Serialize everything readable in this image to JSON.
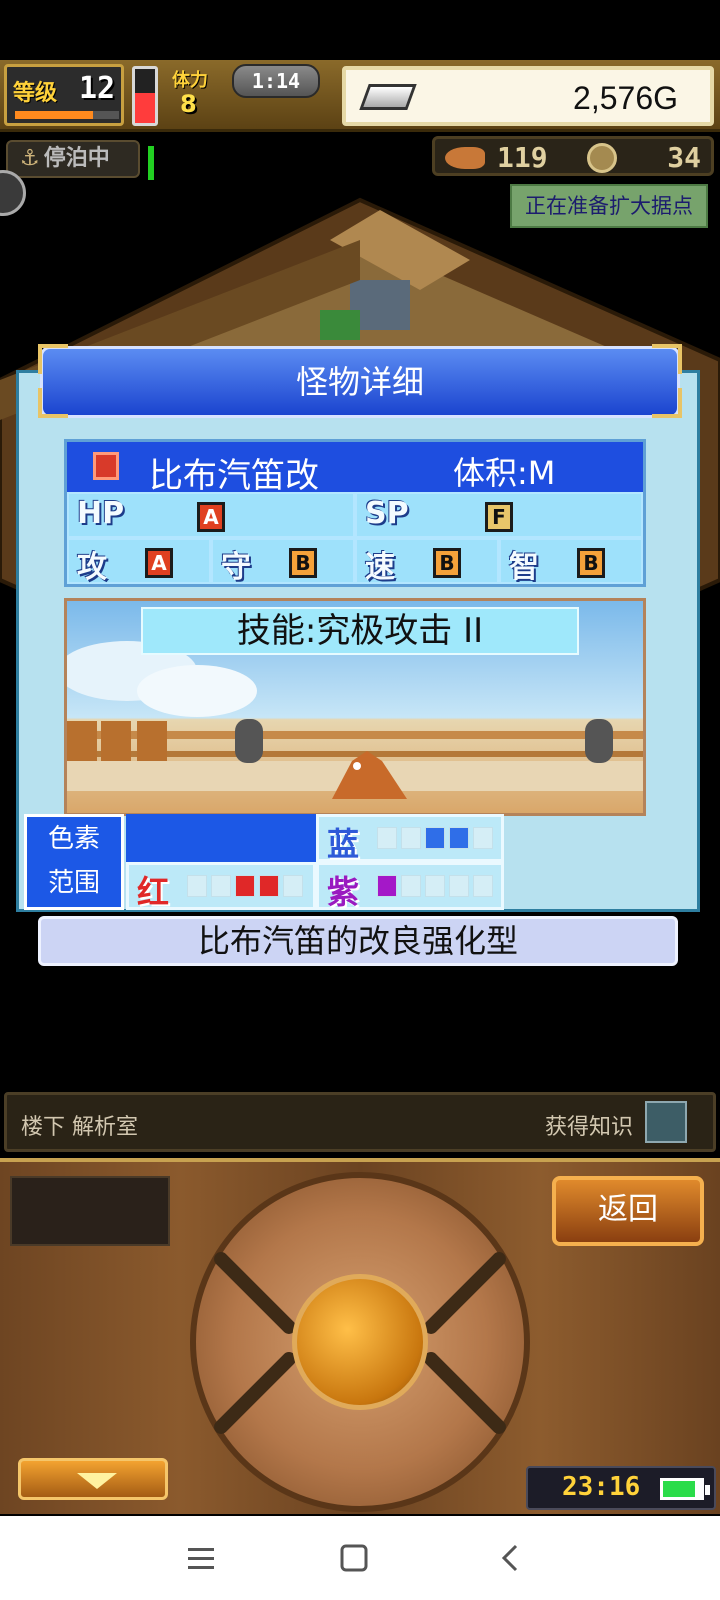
{
  "hud": {
    "level_label": "等级",
    "level": "12",
    "level_progress": 0.75,
    "hp_level": 0.55,
    "stamina_label": "体力",
    "stamina": "8",
    "clock": "1:14",
    "gold": "2,576G"
  },
  "status": {
    "dock_label": "停泊中",
    "fish_count": "119",
    "coin_count": "34",
    "expand_note": "正在准备扩大据点"
  },
  "panel": {
    "title": "怪物详细",
    "monster_name": "比布汽笛改",
    "size": "体积:M",
    "stats": [
      {
        "label": "HP",
        "grade": "A"
      },
      {
        "label": "SP",
        "grade": "F"
      }
    ],
    "stats2": [
      {
        "label": "攻",
        "grade": "A"
      },
      {
        "label": "守",
        "grade": "B"
      },
      {
        "label": "速",
        "grade": "B"
      },
      {
        "label": "智",
        "grade": "B"
      }
    ],
    "skill": "技能:究极攻击 II",
    "pigment_line1": "色素",
    "pigment_line2": "范围",
    "pigments": {
      "blue": {
        "label": "蓝",
        "filled": 2,
        "total": 5,
        "color": "#2f6ee8"
      },
      "red": {
        "label": "红",
        "filled": 2,
        "total": 5,
        "color": "#e02828"
      },
      "purple": {
        "label": "紫",
        "filled": 1,
        "total": 5,
        "color": "#a418c8"
      }
    },
    "description": "比布汽笛的改良强化型"
  },
  "bottom": {
    "location": "楼下 解析室",
    "knowledge": "获得知识",
    "back_label": "返回",
    "time": "23:16",
    "battery_level": 0.85
  },
  "colors": {
    "header_blue": "#1b44cf",
    "panel_bg": "#b7e1ef",
    "accent_gold": "#ffd23a"
  }
}
